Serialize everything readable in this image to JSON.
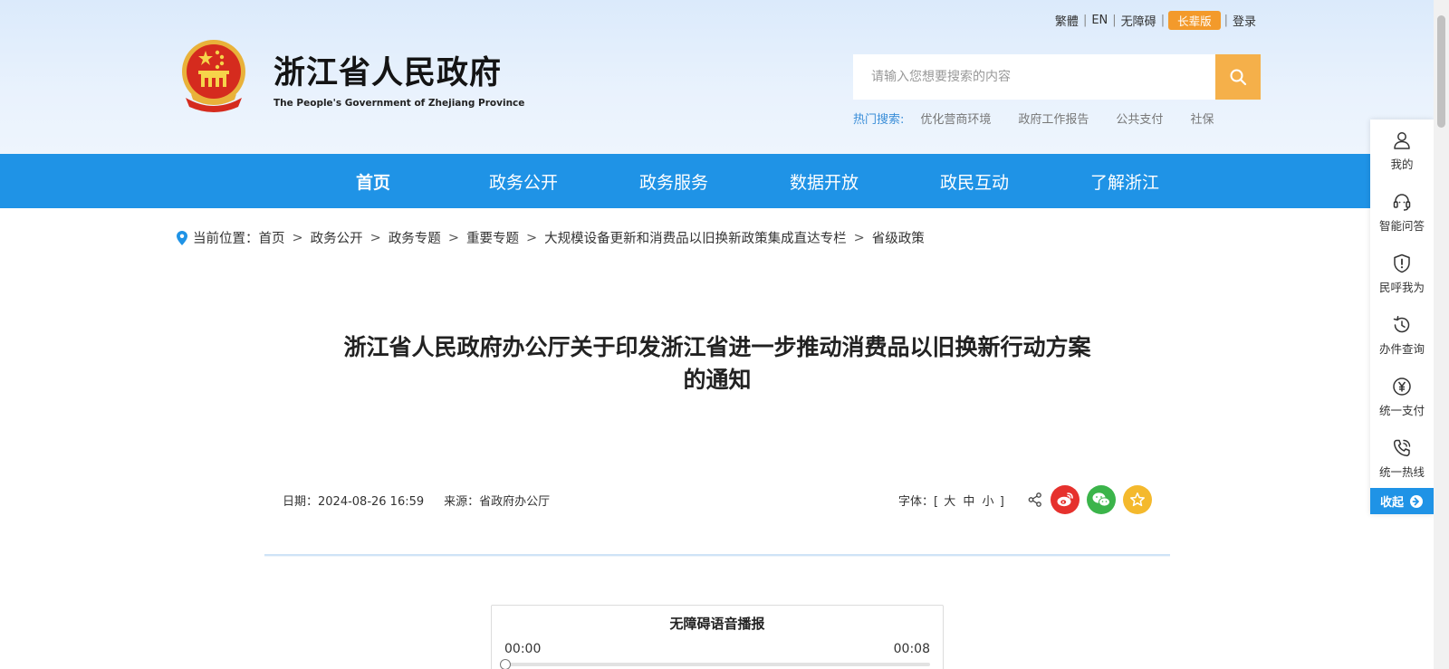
{
  "header": {
    "site_title": "浙江省人民政府",
    "site_subtitle": "The People's Government of Zhejiang Province",
    "toplinks": {
      "traditional": "繁體",
      "english": "EN",
      "accessibility": "无障碍",
      "elder": "长辈版",
      "login": "登录"
    },
    "search": {
      "placeholder": "请输入您想要搜索的内容"
    },
    "hot": {
      "label": "热门搜索:",
      "items": [
        "优化营商环境",
        "政府工作报告",
        "公共支付",
        "社保"
      ]
    }
  },
  "nav": {
    "items": [
      "首页",
      "政务公开",
      "政务服务",
      "数据开放",
      "政民互动",
      "了解浙江"
    ]
  },
  "breadcrumb": {
    "label": "当前位置：",
    "items": [
      "首页",
      "政务公开",
      "政务专题",
      "重要专题",
      "大规模设备更新和消费品以旧换新政策集成直达专栏",
      "省级政策"
    ],
    "separator": ">"
  },
  "article": {
    "title_line1": "浙江省人民政府办公厅关于印发浙江省进一步推动消费品以旧换新行动方案",
    "title_line2": "的通知",
    "date": "日期：2024-08-26 16:59",
    "source": "来源：省政府办公厅",
    "font_label": "字体：[",
    "font_large": "大",
    "font_medium": "中",
    "font_small": "小",
    "font_close": "]"
  },
  "player": {
    "title": "无障碍语音播报",
    "time_start": "00:00",
    "time_end": "00:08",
    "progress": 0
  },
  "sidebar": {
    "items": [
      "我的",
      "智能问答",
      "民呼我为",
      "办件查询",
      "统一支付",
      "统一热线"
    ],
    "collapse": "收起"
  },
  "colors": {
    "nav_blue": "#1f93e6",
    "search_orange": "#f5b04a",
    "elder_orange": "#f39a2b",
    "weibo_red": "#e6312d",
    "wechat_green": "#3bb44a",
    "favorite_yellow": "#f4b92d"
  }
}
